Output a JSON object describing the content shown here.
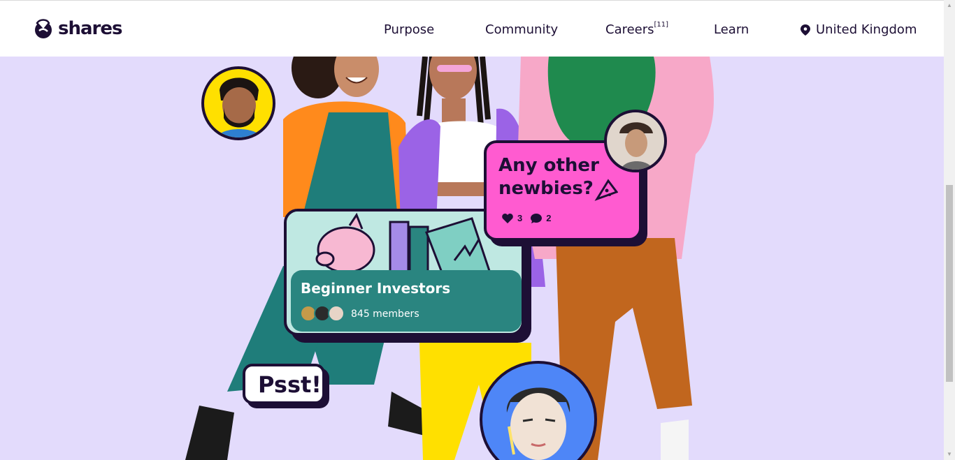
{
  "header": {
    "logo_text": "shares",
    "nav": [
      {
        "label": "Purpose"
      },
      {
        "label": "Community"
      },
      {
        "label": "Careers",
        "badge": "[11]"
      },
      {
        "label": "Learn"
      }
    ],
    "country": "United Kingdom"
  },
  "hero": {
    "background": "#e3dbfc",
    "investors_card": {
      "title": "Beginner Investors",
      "members": "845 members"
    },
    "newbies_bubble": {
      "text": "Any other newbies?",
      "likes": "3",
      "comments": "2"
    },
    "psst_bubble": {
      "text": "Psst!"
    }
  },
  "colors": {
    "brand_dark": "#1d0f35",
    "card_teal": "#2a8580",
    "bubble_pink": "#ff5bd0",
    "avatar_yellow": "#ffe000",
    "avatar_blue": "#4e86f7"
  }
}
